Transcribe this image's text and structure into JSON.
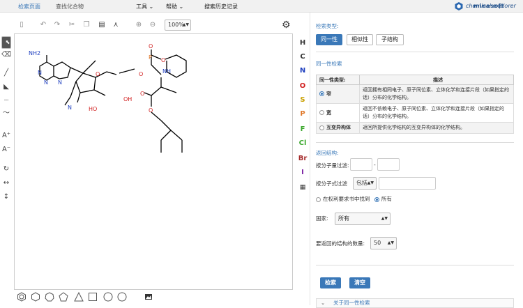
{
  "topbar": {
    "home": "检索页面",
    "find_compound": "查找化合物",
    "tools": "工具 ⌄",
    "help": "帮助 ⌄",
    "history": "搜索历史记录",
    "brand": "minesoft",
    "product": "chemical explorer"
  },
  "toolbar": {
    "zoom": "100%"
  },
  "elements": [
    {
      "symbol": "H",
      "color": "#000000"
    },
    {
      "symbol": "C",
      "color": "#000000"
    },
    {
      "symbol": "N",
      "color": "#1f3fbf"
    },
    {
      "symbol": "O",
      "color": "#d11f1f"
    },
    {
      "symbol": "S",
      "color": "#c9a000"
    },
    {
      "symbol": "P",
      "color": "#e0782a"
    },
    {
      "symbol": "F",
      "color": "#3ca82e"
    },
    {
      "symbol": "Cl",
      "color": "#3ca82e"
    },
    {
      "symbol": "Br",
      "color": "#a52a2a"
    },
    {
      "symbol": "I",
      "color": "#7a1fa2"
    }
  ],
  "molecule": {
    "atoms": [
      "NH2",
      "N",
      "N",
      "N",
      "N",
      "O",
      "HO",
      "OH",
      "O",
      "O",
      "P",
      "O",
      "NH",
      "O",
      "O",
      "N",
      "N"
    ]
  },
  "right": {
    "search_type_label": "检索类型:",
    "tabs": [
      "同一性",
      "相似性",
      "子结构"
    ],
    "identity_label": "同一性检索",
    "table_headers": [
      "同一性类型:",
      "描述"
    ],
    "rows": [
      {
        "type": "窄",
        "desc": "返回拥有相同电子、原子同位素、立体化学和连接片段（如果指定的话）分布的化学结构。",
        "selected": true
      },
      {
        "type": "宽",
        "desc": "返回不依赖电子、原子同位素、立体化学和连接片段（如果指定的话）分布的化学结构。",
        "selected": false
      },
      {
        "type": "互变异构体",
        "desc": "返回所提供化学结构的互变异构体的化学结构。",
        "selected": false
      }
    ],
    "return_label": "返回结构:",
    "mw_filter": "按分子量过滤:",
    "mw_dash": "-",
    "formula_filter": "按分子式过滤",
    "formula_mode": "包括",
    "claims_option": "在权利要求书中找到",
    "all_option": "所有",
    "country_label": "国家:",
    "country_value": "所有",
    "count_label": "要返回的结构的数量:",
    "count_value": "50",
    "search_btn": "检索",
    "clear_btn": "清空",
    "about": "关于同一性检索"
  }
}
